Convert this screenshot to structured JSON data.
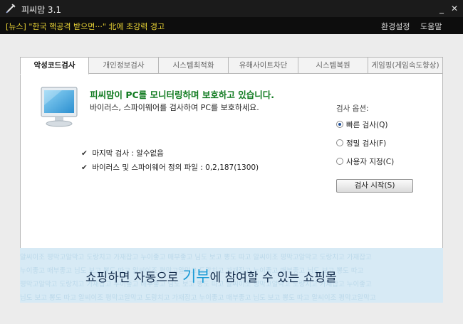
{
  "window": {
    "title": "피씨맘 3.1",
    "minimize": "_",
    "close": "✕"
  },
  "header": {
    "news": "[뉴스] \"한국 핵공격 받으면···\" 北에 초강력 경고",
    "settings": "환경설정",
    "help": "도움말"
  },
  "tabs": [
    {
      "label": "악성코드검사",
      "active": true
    },
    {
      "label": "개인정보검사"
    },
    {
      "label": "시스템최적화"
    },
    {
      "label": "유해사이트차단"
    },
    {
      "label": "시스템복원"
    },
    {
      "label": "게임핑(게임속도향상)"
    }
  ],
  "main": {
    "headline": "피씨맘이 PC를 모니터링하며 보호하고 있습니다.",
    "subline": "바이러스, 스파이웨어를 검사하여 PC를 보호하세요.",
    "last_scan_label": "마지막 검사 :",
    "last_scan_value": "알수없음",
    "definition_label": "바이러스 및 스파이웨어 정의 파일 :",
    "definition_value": "0,2,187(1300)"
  },
  "options": {
    "title": "검사 옵션:",
    "items": [
      {
        "label": "빠른 검사(Q)",
        "selected": true
      },
      {
        "label": "정밀 검사(F)",
        "selected": false
      },
      {
        "label": "사용자 지정(C)",
        "selected": false
      }
    ],
    "start_button": "검사 시작(S)"
  },
  "banner": {
    "text_before": "쇼핑하면 자동으로 ",
    "highlight": "기부",
    "text_after": "에 참여할 수 있는 쇼핑몰",
    "bg_rows": [
      "알씨이조  평막고알막고  도랑치고 가재잡고  누이좋고 매부좋고  님도 보고 뽕도 따고  알씨이조  평막고알막고  도랑치고 가재잡고",
      "누이좋고 매부좋고  님도 보고 뽕도 따고  알씨이조  평막고알막고  도랑치고 가재잡고  누이좋고 매부좋고  님도 보고 뽕도 따고",
      "평막고알막고  도랑치고 가재잡고  누이좋고 매부좋고  님도 보고 뽕도 따고  알씨이조  평막고알막고  도랑치고 가재잡고  누이좋고",
      "님도 보고 뽕도 따고  알씨이조  평막고알막고  도랑치고 가재잡고  누이좋고 매부좋고  님도 보고 뽕도 따고  알씨이조  평막고알막고"
    ]
  },
  "colors": {
    "headline": "#0f7a1f",
    "news": "#e8d235",
    "banner_bg": "#d7eaf5",
    "banner_highlight": "#1c9bd6"
  },
  "icons": {
    "app": "syringe-icon",
    "monitor": "monitor-icon",
    "check": "checkmark-icon"
  }
}
